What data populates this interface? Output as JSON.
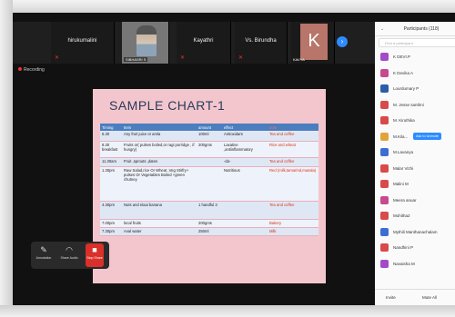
{
  "meeting": {
    "tiles": [
      {
        "name": "hirukumalini",
        "type": "name"
      },
      {
        "name": "SIBHASRI S",
        "type": "video"
      },
      {
        "name": "Kayathri",
        "type": "name"
      },
      {
        "name": "Vs. Birundha",
        "type": "name"
      },
      {
        "name": "KAVYA",
        "type": "avatar",
        "letter": "K"
      }
    ],
    "recording_label": "Recording"
  },
  "slide": {
    "title": "SAMPLE CHART-1",
    "headers": [
      "Timing",
      "Item",
      "amount",
      "effect",
      "note"
    ],
    "rows": [
      {
        "timing": "6.30",
        "item": "Any fruit juice or amla",
        "amount": "100ml",
        "effect": "Antioxidant",
        "note": "Tea and coffee"
      },
      {
        "timing": "8.30 breakfast",
        "item": "Fruits or( pulses boiled,or ragi porridge , if hungry)",
        "amount": "200gms",
        "effect": "Laxative ,antiinflammatory",
        "note": "Rice and wheat"
      },
      {
        "timing": "11.30am",
        "item": "Fruit ,sprouts ,dates",
        "amount": "",
        "effect": "-do-",
        "note": "Tea and coffee"
      },
      {
        "timing": "1.30pm",
        "item": "Raw Salad,rice Or Wheat ,Veg Stirfry+ pulses Or Vegetables Boiled +green chutney",
        "amount": "",
        "effect": "Nutritious",
        "note": "Red (milk,tamarind,masala)"
      },
      {
        "timing": "4.30pm",
        "item": "Nuts and elaai banana",
        "amount": "1 handful 3",
        "effect": "",
        "note": "Tea and coffee"
      },
      {
        "timing": "7.00pm",
        "item": "local fruits",
        "amount": "200gms",
        "effect": "",
        "note": "Bakery"
      },
      {
        "timing": "7.30pm",
        "item": "Aval water",
        "amount": "250ml",
        "effect": "",
        "note": "Milk"
      }
    ]
  },
  "controls": {
    "annotation": "Annotation",
    "share_audio": "Share Audio",
    "stop_share": "Stop Share"
  },
  "participants": {
    "title": "Participants (118)",
    "search_placeholder": "Find a participant",
    "list": [
      {
        "name": "K DEVI.P",
        "color": "#a54ac7"
      },
      {
        "name": "K Devika A",
        "color": "#c74a8e"
      },
      {
        "name": "Lourdumary P",
        "color": "#2b5ea8"
      },
      {
        "name": "M. Jesse santhni",
        "color": "#d94a4a"
      },
      {
        "name": "M. Kiruthika",
        "color": "#d94a4a"
      },
      {
        "name": "M.Kila...",
        "color": "#e0a43c",
        "button": "Ask to Unmute"
      },
      {
        "name": "M.Lavanya",
        "color": "#3c6fd1"
      },
      {
        "name": "Malar Vizhi",
        "color": "#d94a4a"
      },
      {
        "name": "Malini M",
        "color": "#d94a4a"
      },
      {
        "name": "Meera anuar",
        "color": "#c74a8e"
      },
      {
        "name": "Mohitha2",
        "color": "#d94a4a"
      },
      {
        "name": "Mythili Manthanachalam",
        "color": "#3c6fd1"
      },
      {
        "name": "Nandhini P",
        "color": "#d94a4a"
      },
      {
        "name": "Navaisha M",
        "color": "#a54ac7"
      }
    ],
    "invite": "Invite",
    "mute_all": "Mute All"
  }
}
